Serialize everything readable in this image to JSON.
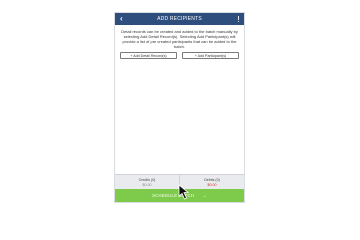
{
  "header": {
    "title": "ADD RECIPIENTS",
    "back_icon": "chevron-left-icon",
    "menu_icon": "kebab-menu-icon"
  },
  "description": "Detail records can be created and added to the batch manually by selecting Add Detail Record(s). Selecting Add Participant(s) will provide a list of pre created participants that can be added to the batch.",
  "buttons": {
    "add_detail": "+ Add Detail Record(s)",
    "add_participant": "+ Add Participant(s)"
  },
  "totals": {
    "credits_label": "Credits (0)",
    "credits_amount": "$0.00",
    "debits_label": "Debits (0)",
    "debits_amount": "$0.00"
  },
  "footer": {
    "schedule_label": "SCHEDULE BATCH",
    "arrow": "→"
  },
  "colors": {
    "header": "#2e4f7d",
    "schedule": "#7ecb4b",
    "debit_amount": "#d0342c"
  }
}
